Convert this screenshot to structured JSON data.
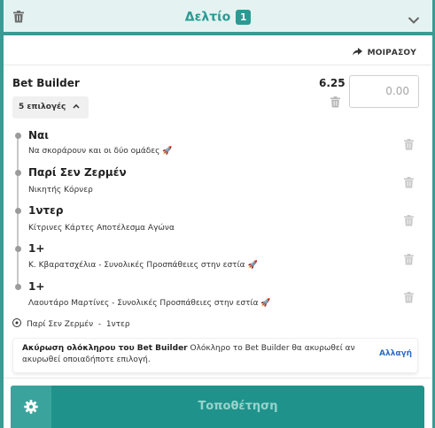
{
  "header": {
    "title": "Δελτίο",
    "count": "1",
    "icons": {
      "clear": "trash-icon",
      "collapse": "chevron-down-icon"
    }
  },
  "share": {
    "label": "ΜΟΙΡΑΣΟΥ",
    "icon": "share-arrow-icon"
  },
  "bet_builder": {
    "title": "Bet Builder",
    "odds": "6.25",
    "stake_placeholder": "0.00",
    "options_label": "5 επιλογές"
  },
  "selections": [
    {
      "name": "Ναι",
      "market": "Να σκοράρουν και οι δύο ομάδες",
      "rocket": true
    },
    {
      "name": "Παρί Σεν Ζερμέν",
      "market": "Νικητής Κόρνερ",
      "rocket": false
    },
    {
      "name": "1ντερ",
      "market": "Κίτρινες Κάρτες Αποτέλεσμα Αγώνα",
      "rocket": false
    },
    {
      "name": "1+",
      "market": "Κ. Κβαρατσχέλια - Συνολικές Προσπάθειες στην εστία",
      "rocket": true
    },
    {
      "name": "1+",
      "market": "Λαουτάρο Μαρτίνες - Συνολικές Προσπάθειες στην εστία",
      "rocket": true
    }
  ],
  "event": {
    "home": "Παρί Σεν Ζερμέν",
    "separator": "-",
    "away": "1ντερ"
  },
  "notice": {
    "bold": "Ακύρωση ολόκληρου του Bet Builder",
    "text": "Ολόκληρο το Bet Builder θα ακυρωθεί αν ακυρωθεί οποιαδήποτε επιλογή.",
    "change_label": "Αλλαγή"
  },
  "place_bet": {
    "label": "Τοποθέτηση"
  },
  "colors": {
    "accent": "#2a9a93",
    "button": "#1f938b",
    "link": "#2a6fbf"
  }
}
